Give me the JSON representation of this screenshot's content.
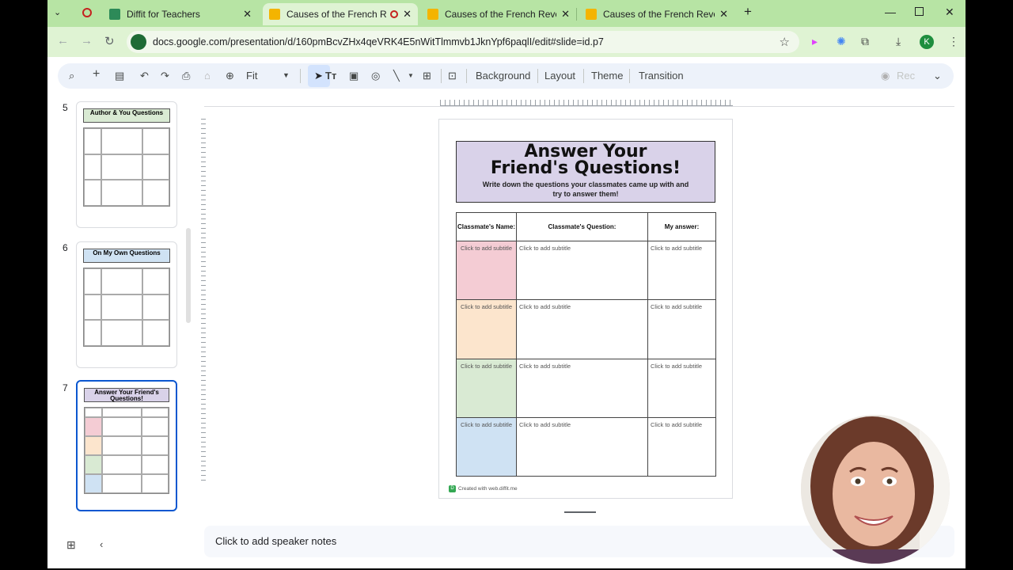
{
  "browser": {
    "tabs": [
      {
        "title": "Diffit for Teachers",
        "favicon_color": "#2d8a58",
        "active": false,
        "recording": false
      },
      {
        "title": "Causes of the French Revolu",
        "favicon_color": "#f4b400",
        "active": true,
        "recording": true
      },
      {
        "title": "Causes of the French Revolution",
        "favicon_color": "#f4b400",
        "active": false,
        "recording": false
      },
      {
        "title": "Causes of the French Revolution",
        "favicon_color": "#f4b400",
        "active": false,
        "recording": false
      }
    ],
    "new_tab_icon": "plus-icon",
    "url": "docs.google.com/presentation/d/160pmBcvZHx4qeVRK4E5nWitTlmmvb1JknYpf6paqlI/edit#slide=id.p7",
    "profile_initial": "K",
    "theme_color": "#b7e4a4"
  },
  "toolbar": {
    "zoom": "Fit",
    "background_label": "Background",
    "layout_label": "Layout",
    "theme_label": "Theme",
    "transition_label": "Transition",
    "rec_label": "Rec"
  },
  "filmstrip": {
    "slides": [
      {
        "number": "5",
        "title": "Author & You Questions",
        "header_color": "#d9ead3",
        "selected": false
      },
      {
        "number": "6",
        "title": "On My Own Questions",
        "header_color": "#cfe2f3",
        "selected": false
      },
      {
        "number": "7",
        "title": "Answer Your Friend's Questions!",
        "header_color": "#d9d2e9",
        "selected": true
      }
    ]
  },
  "slide": {
    "title": "Answer Your Friend's Questions!",
    "subtitle": "Write down the questions your classmates came up with and try to answer them!",
    "columns": [
      "Classmate's Name:",
      "Classmate's Question:",
      "My answer:"
    ],
    "rows": [
      {
        "color": "#f4ccd4",
        "cells": [
          "Click to add subtitle",
          "Click to add subtitle",
          "Click to add subtitle"
        ]
      },
      {
        "color": "#fce5cd",
        "cells": [
          "Click to add subtitle",
          "Click to add subtitle",
          "Click to add subtitle"
        ]
      },
      {
        "color": "#d9ead3",
        "cells": [
          "Click to add subtitle",
          "Click to add subtitle",
          "Click to add subtitle"
        ]
      },
      {
        "color": "#cfe2f3",
        "cells": [
          "Click to add subtitle",
          "Click to add subtitle",
          "Click to add subtitle"
        ]
      }
    ],
    "footer": "Created with web.diffit.me"
  },
  "notes": {
    "placeholder": "Click to add speaker notes"
  }
}
